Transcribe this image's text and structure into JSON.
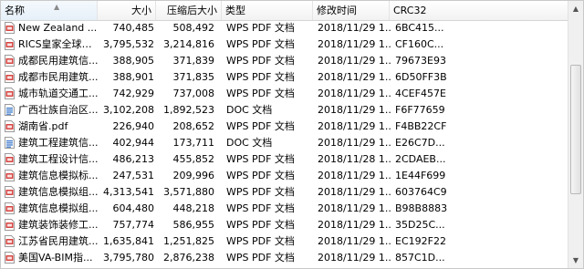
{
  "columns": {
    "name": "名称",
    "size": "大小",
    "compressed": "压缩后大小",
    "type": "类型",
    "modified": "修改时间",
    "crc": "CRC32"
  },
  "sort": {
    "column": "name",
    "indicator": "up-arrow-icon"
  },
  "files": [
    {
      "icon": "pdf-file-icon",
      "name": "New Zealand ...",
      "size": "740,485",
      "compressed": "508,492",
      "type": "WPS PDF 文档",
      "modified": "2018/11/29 1...",
      "crc": "6BC415..."
    },
    {
      "icon": "pdf-file-icon",
      "name": "RICS皇家全球专...",
      "size": "3,795,532",
      "compressed": "3,214,816",
      "type": "WPS PDF 文档",
      "modified": "2018/11/29 1...",
      "crc": "CF160C..."
    },
    {
      "icon": "pdf-file-icon",
      "name": "成都民用建筑信...",
      "size": "388,905",
      "compressed": "371,839",
      "type": "WPS PDF 文档",
      "modified": "2018/11/29 1...",
      "crc": "79673E93"
    },
    {
      "icon": "pdf-file-icon",
      "name": "成都市民用建筑...",
      "size": "388,901",
      "compressed": "371,835",
      "type": "WPS PDF 文档",
      "modified": "2018/11/29 1...",
      "crc": "6D50FF3B"
    },
    {
      "icon": "pdf-file-icon",
      "name": "城市轨道交通工...",
      "size": "742,929",
      "compressed": "737,008",
      "type": "WPS PDF 文档",
      "modified": "2018/11/29 1...",
      "crc": "4CEF457E"
    },
    {
      "icon": "doc-file-icon",
      "name": "广西壮族自治区...",
      "size": "3,102,208",
      "compressed": "1,892,523",
      "type": "DOC 文档",
      "modified": "2018/11/29 1...",
      "crc": "F6F77659"
    },
    {
      "icon": "pdf-file-icon",
      "name": "湖南省.pdf",
      "size": "226,940",
      "compressed": "208,652",
      "type": "WPS PDF 文档",
      "modified": "2018/11/29 1...",
      "crc": "F4BB22CF"
    },
    {
      "icon": "doc-file-icon",
      "name": "建筑工程建筑信...",
      "size": "402,944",
      "compressed": "173,711",
      "type": "DOC 文档",
      "modified": "2018/11/29 1...",
      "crc": "E26C7D..."
    },
    {
      "icon": "pdf-file-icon",
      "name": "建筑工程设计信...",
      "size": "486,213",
      "compressed": "455,852",
      "type": "WPS PDF 文档",
      "modified": "2018/11/28 1...",
      "crc": "2CDAEB..."
    },
    {
      "icon": "pdf-file-icon",
      "name": "建筑信息模拟标...",
      "size": "247,531",
      "compressed": "209,996",
      "type": "WPS PDF 文档",
      "modified": "2018/11/29 1...",
      "crc": "1E44F699"
    },
    {
      "icon": "pdf-file-icon",
      "name": "建筑信息模拟组...",
      "size": "4,313,541",
      "compressed": "3,571,880",
      "type": "WPS PDF 文档",
      "modified": "2018/11/29 1...",
      "crc": "603764C9"
    },
    {
      "icon": "pdf-file-icon",
      "name": "建筑信息模拟组...",
      "size": "604,480",
      "compressed": "448,218",
      "type": "WPS PDF 文档",
      "modified": "2018/11/29 1...",
      "crc": "B98B8883"
    },
    {
      "icon": "pdf-file-icon",
      "name": "建筑装饰装修工...",
      "size": "757,774",
      "compressed": "586,955",
      "type": "WPS PDF 文档",
      "modified": "2018/11/29 1...",
      "crc": "35D25C..."
    },
    {
      "icon": "pdf-file-icon",
      "name": "江苏省民用建筑...",
      "size": "1,635,841",
      "compressed": "1,251,825",
      "type": "WPS PDF 文档",
      "modified": "2018/11/29 1...",
      "crc": "EC192F22"
    },
    {
      "icon": "pdf-file-icon",
      "name": "美国VA-BIM指...",
      "size": "3,795,780",
      "compressed": "2,876,238",
      "type": "WPS PDF 文档",
      "modified": "2018/11/29 1...",
      "crc": "857C1D..."
    }
  ],
  "scrollbar": {
    "position": 0.45,
    "visible_fraction": 0.55
  },
  "colors": {
    "pdf_icon": "#d64541",
    "doc_icon": "#2f6fc6",
    "header_bg": "#f5f5f5"
  }
}
